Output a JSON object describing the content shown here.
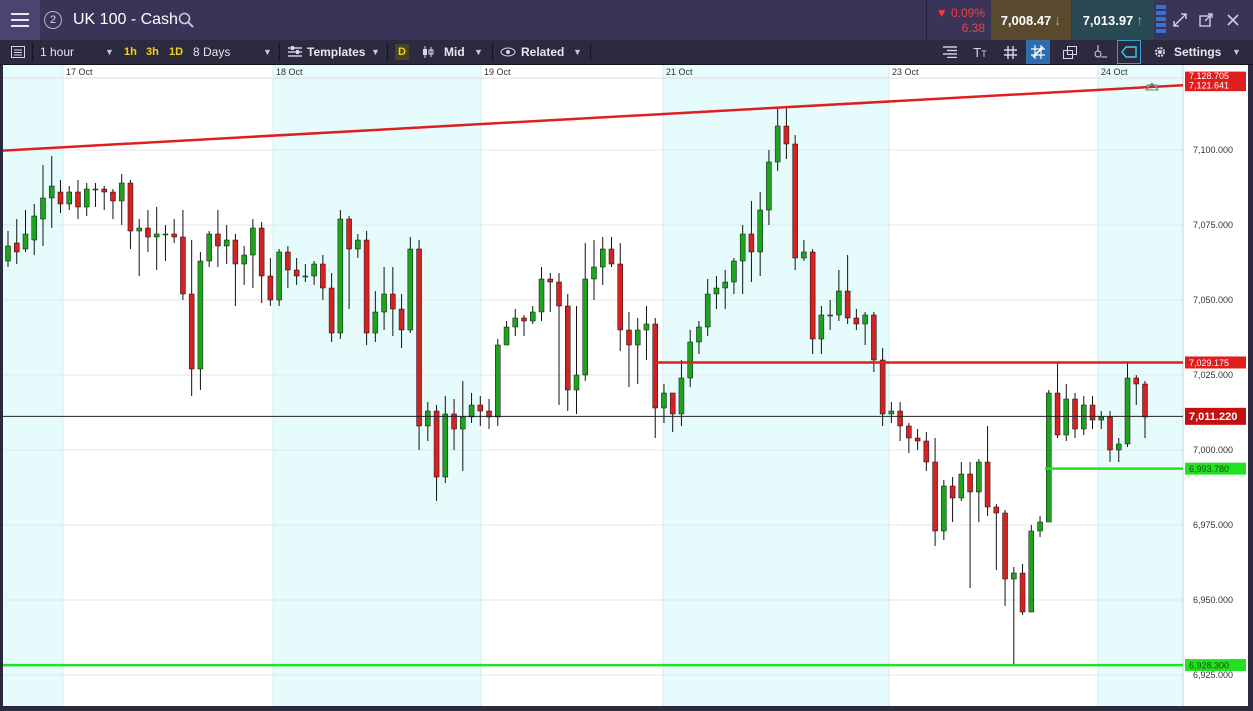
{
  "header": {
    "layout_icon": "hamburger-icon",
    "workspace_number": "2",
    "title": "UK 100 - Cash",
    "change_pct": "▼ 0.09%",
    "change_abs": "6.38",
    "sell_price": "7,008.47",
    "buy_price": "7,013.97"
  },
  "toolbar": {
    "interval": "1 hour",
    "quick_1h": "1h",
    "quick_3h": "3h",
    "quick_1d": "1D",
    "range": "8 Days",
    "templates": "Templates",
    "d_label": "D",
    "price_type": "Mid",
    "related": "Related",
    "settings": "Settings"
  },
  "colors": {
    "up": "#1ea31e",
    "down": "#d42121",
    "resistance": "#e01e1e",
    "support": "#22e022",
    "shade": "#e6fbfc"
  },
  "chart_data": {
    "type": "candlestick",
    "x_labels": [
      "17 Oct",
      "18 Oct",
      "19 Oct",
      "21 Oct",
      "23 Oct",
      "24 Oct"
    ],
    "y_ticks": [
      "7,100.000",
      "7,075.000",
      "7,050.000",
      "7,025.000",
      "7,000.000",
      "6,975.000",
      "6,950.000",
      "6,925.000"
    ],
    "ylim": [
      6924,
      7125
    ],
    "price_tags": {
      "top_hidden": "7,128.705",
      "trendline": "7,121.641",
      "resistance": "7,029.175",
      "current": "7,011.220",
      "support_upper": "6,993.780",
      "support_lower": "6,928.300"
    },
    "trendline": {
      "start": 7099.8,
      "end": 7121.6
    },
    "resistance_level": 7029.175,
    "current_level": 7011.22,
    "support_upper_level": 6993.78,
    "support_lower_level": 6928.3,
    "candles": [
      [
        7063,
        7068,
        7061,
        7073
      ],
      [
        7069,
        7066,
        7062,
        7077
      ],
      [
        7067,
        7072,
        7066,
        7080
      ],
      [
        7070,
        7078,
        7065,
        7082
      ],
      [
        7077,
        7084,
        7068,
        7095
      ],
      [
        7084,
        7088,
        7074,
        7098
      ],
      [
        7086,
        7082,
        7079,
        7090
      ],
      [
        7082,
        7086,
        7080,
        7088
      ],
      [
        7086,
        7081,
        7077,
        7090
      ],
      [
        7081,
        7087,
        7078,
        7089
      ],
      [
        7087,
        7087,
        7081,
        7089
      ],
      [
        7087,
        7086,
        7080,
        7088
      ],
      [
        7086,
        7083,
        7077,
        7087
      ],
      [
        7083,
        7089,
        7075,
        7092
      ],
      [
        7089,
        7073,
        7067,
        7090
      ],
      [
        7073,
        7074,
        7058,
        7077
      ],
      [
        7074,
        7071,
        7066,
        7080
      ],
      [
        7071,
        7072,
        7060,
        7081
      ],
      [
        7072,
        7072,
        7063,
        7075
      ],
      [
        7072,
        7071,
        7069,
        7077
      ],
      [
        7071,
        7052,
        7050,
        7080
      ],
      [
        7052,
        7027,
        7018,
        7070
      ],
      [
        7027,
        7063,
        7020,
        7066
      ],
      [
        7063,
        7072,
        7061,
        7073
      ],
      [
        7072,
        7068,
        7061,
        7080
      ],
      [
        7068,
        7070,
        7062,
        7075
      ],
      [
        7070,
        7062,
        7048,
        7072
      ],
      [
        7062,
        7065,
        7055,
        7068
      ],
      [
        7065,
        7074,
        7054,
        7077
      ],
      [
        7074,
        7058,
        7049,
        7076
      ],
      [
        7058,
        7050,
        7048,
        7064
      ],
      [
        7050,
        7066,
        7048,
        7067
      ],
      [
        7066,
        7060,
        7054,
        7068
      ],
      [
        7060,
        7058,
        7055,
        7064
      ],
      [
        7058,
        7058,
        7056,
        7062
      ],
      [
        7058,
        7062,
        7055,
        7063
      ],
      [
        7062,
        7054,
        7050,
        7065
      ],
      [
        7054,
        7039,
        7036,
        7059
      ],
      [
        7039,
        7077,
        7037,
        7080
      ],
      [
        7077,
        7067,
        7047,
        7078
      ],
      [
        7067,
        7070,
        7064,
        7072
      ],
      [
        7070,
        7039,
        7035,
        7073
      ],
      [
        7039,
        7046,
        7036,
        7053
      ],
      [
        7046,
        7052,
        7040,
        7061
      ],
      [
        7052,
        7047,
        7038,
        7061
      ],
      [
        7047,
        7040,
        7034,
        7052
      ],
      [
        7040,
        7067,
        7039,
        7071
      ],
      [
        7067,
        7008,
        7000,
        7070
      ],
      [
        7008,
        7013,
        7003,
        7016
      ],
      [
        7013,
        6991,
        6983,
        7015
      ],
      [
        6991,
        7012,
        6989,
        7018
      ],
      [
        7012,
        7007,
        7000,
        7017
      ],
      [
        7007,
        7011,
        6993,
        7023
      ],
      [
        7011,
        7015,
        7009,
        7019
      ],
      [
        7015,
        7013,
        7008,
        7018
      ],
      [
        7013,
        7011,
        7007,
        7017
      ],
      [
        7011,
        7035,
        7008,
        7037
      ],
      [
        7035,
        7041,
        7035,
        7043
      ],
      [
        7041,
        7044,
        7038,
        7047
      ],
      [
        7044,
        7043,
        7038,
        7045
      ],
      [
        7043,
        7046,
        7042,
        7048
      ],
      [
        7046,
        7057,
        7043,
        7061
      ],
      [
        7057,
        7056,
        7046,
        7059
      ],
      [
        7056,
        7048,
        7015,
        7059
      ],
      [
        7048,
        7020,
        7013,
        7052
      ],
      [
        7020,
        7025,
        7012,
        7048
      ],
      [
        7025,
        7057,
        7023,
        7069
      ],
      [
        7057,
        7061,
        7050,
        7070
      ],
      [
        7061,
        7067,
        7055,
        7071
      ],
      [
        7067,
        7062,
        7061,
        7071
      ],
      [
        7062,
        7040,
        7033,
        7069
      ],
      [
        7040,
        7035,
        7021,
        7046
      ],
      [
        7035,
        7040,
        7022,
        7044
      ],
      [
        7040,
        7042,
        7030,
        7048
      ],
      [
        7042,
        7014,
        7004,
        7044
      ],
      [
        7014,
        7019,
        7009,
        7022
      ],
      [
        7019,
        7012,
        7006,
        7018
      ],
      [
        7012,
        7024,
        7008,
        7030
      ],
      [
        7024,
        7036,
        7021,
        7040
      ],
      [
        7036,
        7041,
        7032,
        7043
      ],
      [
        7041,
        7052,
        7038,
        7057
      ],
      [
        7052,
        7054,
        7047,
        7058
      ],
      [
        7054,
        7056,
        7047,
        7060
      ],
      [
        7056,
        7063,
        7052,
        7064
      ],
      [
        7063,
        7072,
        7052,
        7075
      ],
      [
        7072,
        7066,
        7056,
        7083
      ],
      [
        7066,
        7080,
        7058,
        7086
      ],
      [
        7080,
        7096,
        7075,
        7100
      ],
      [
        7096,
        7108,
        7093,
        7114
      ],
      [
        7108,
        7102,
        7097,
        7114
      ],
      [
        7102,
        7064,
        7060,
        7105
      ],
      [
        7064,
        7066,
        7063,
        7070
      ],
      [
        7066,
        7037,
        7032,
        7067
      ],
      [
        7037,
        7045,
        7032,
        7048
      ],
      [
        7045,
        7045,
        7040,
        7050
      ],
      [
        7045,
        7053,
        7043,
        7060
      ],
      [
        7053,
        7044,
        7042,
        7065
      ],
      [
        7044,
        7042,
        7040,
        7047
      ],
      [
        7042,
        7045,
        7035,
        7046
      ],
      [
        7045,
        7030,
        7026,
        7046
      ],
      [
        7030,
        7012,
        7008,
        7034
      ],
      [
        7012,
        7013,
        7009,
        7016
      ],
      [
        7013,
        7008,
        7003,
        7016
      ],
      [
        7008,
        7004,
        6999,
        7009
      ],
      [
        7004,
        7003,
        7000,
        7007
      ],
      [
        7003,
        6996,
        6993,
        7006
      ],
      [
        6996,
        6973,
        6968,
        7004
      ],
      [
        6973,
        6988,
        6970,
        6990
      ],
      [
        6988,
        6984,
        6976,
        6991
      ],
      [
        6984,
        6992,
        6983,
        6996
      ],
      [
        6992,
        6986,
        6954,
        6996
      ],
      [
        6986,
        6996,
        6976,
        6997
      ],
      [
        6996,
        6981,
        6978,
        7008
      ],
      [
        6981,
        6979,
        6960,
        6982
      ],
      [
        6979,
        6957,
        6948,
        6980
      ],
      [
        6957,
        6959,
        6928,
        6961
      ],
      [
        6959,
        6946,
        6945,
        6962
      ],
      [
        6946,
        6973,
        6946,
        6975
      ],
      [
        6973,
        6976,
        6971,
        6978
      ],
      [
        6976,
        7019,
        6976,
        7020
      ],
      [
        7019,
        7005,
        7004,
        7029
      ],
      [
        7005,
        7017,
        7003,
        7022
      ],
      [
        7017,
        7007,
        7004,
        7019
      ],
      [
        7007,
        7015,
        7005,
        7018
      ],
      [
        7015,
        7010,
        7007,
        7018
      ],
      [
        7010,
        7011,
        7007,
        7013
      ],
      [
        7011,
        7000,
        6996,
        7013
      ],
      [
        7000,
        7002,
        6996,
        7004
      ],
      [
        7002,
        7024,
        7001,
        7029
      ],
      [
        7024,
        7022,
        7015,
        7025
      ],
      [
        7022,
        7011,
        7004,
        7023
      ]
    ]
  }
}
